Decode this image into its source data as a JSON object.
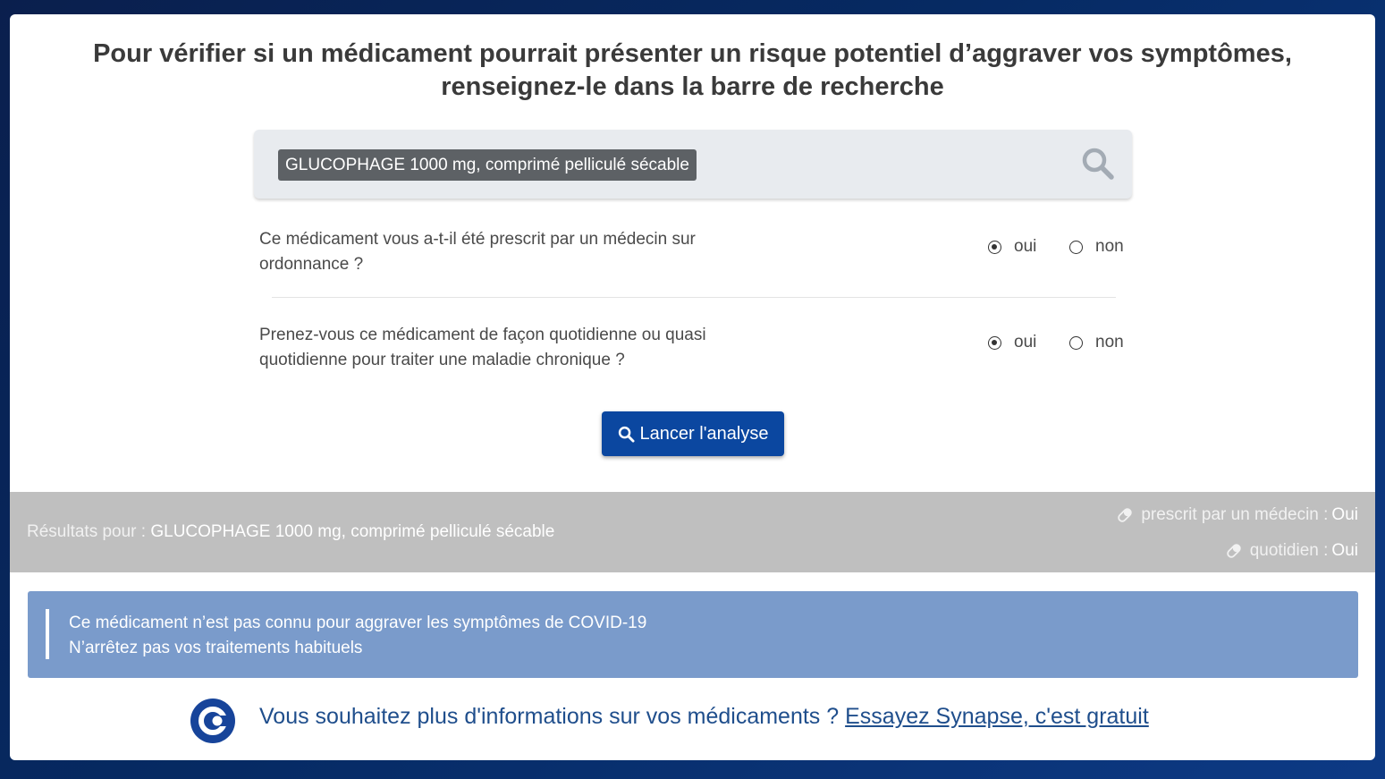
{
  "header": {
    "line1": "Pour vérifier si un médicament pourrait présenter un risque potentiel d’aggraver vos symptômes,",
    "line2": "renseignez-le dans la barre de recherche"
  },
  "search": {
    "value": "GLUCOPHAGE 1000 mg, comprimé pelliculé sécable",
    "icon": "search-icon"
  },
  "questions": [
    {
      "line1": "Ce médicament vous a-t-il été prescrit par un médecin sur",
      "line2": "ordonnance ?",
      "options": [
        "oui",
        "non"
      ],
      "selected": "oui"
    },
    {
      "line1": "Prenez-vous ce médicament de façon quotidienne ou quasi",
      "line2": "quotidienne pour traiter une maladie chronique ?",
      "options": [
        "oui",
        "non"
      ],
      "selected": "oui"
    }
  ],
  "analyse_button": {
    "label": "Lancer l'analyse",
    "icon": "search-icon"
  },
  "results": {
    "prefix": "Résultats pour :",
    "query": "GLUCOPHAGE 1000 mg, comprimé pelliculé sécable",
    "prescribed_label": "prescrit par un médecin :",
    "prescribed_value": "Oui",
    "daily_label": "quotidien :",
    "daily_value": "Oui",
    "icon": "pill-icon"
  },
  "alert": {
    "line1": "Ce médicament n’est pas connu pour aggraver les symptômes de COVID-19",
    "line2": "N’arrêtez pas vos traitements habituels"
  },
  "promo": {
    "text": "Vous souhaitez plus d'informations sur vos médicaments ?",
    "link": "Essayez Synapse, c'est gratuit",
    "logo": "synapse-logo"
  },
  "colors": {
    "primary_button": "#0b47a0",
    "alert_bg": "#7a9bcb",
    "results_bar": "#bfbfbf",
    "link": "#1f4e8c"
  }
}
